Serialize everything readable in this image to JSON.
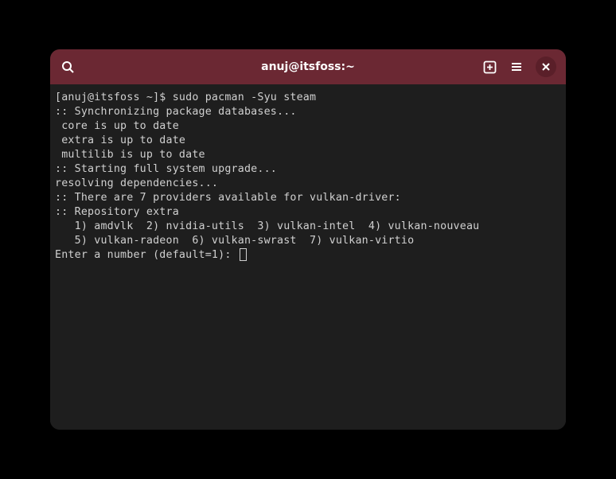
{
  "titlebar": {
    "title": "anuj@itsfoss:~"
  },
  "terminal": {
    "lines": [
      "[anuj@itsfoss ~]$ sudo pacman -Syu steam",
      ":: Synchronizing package databases...",
      " core is up to date",
      " extra is up to date",
      " multilib is up to date",
      ":: Starting full system upgrade...",
      "resolving dependencies...",
      ":: There are 7 providers available for vulkan-driver:",
      ":: Repository extra",
      "   1) amdvlk  2) nvidia-utils  3) vulkan-intel  4) vulkan-nouveau",
      "   5) vulkan-radeon  6) vulkan-swrast  7) vulkan-virtio",
      "",
      "Enter a number (default=1): "
    ]
  }
}
